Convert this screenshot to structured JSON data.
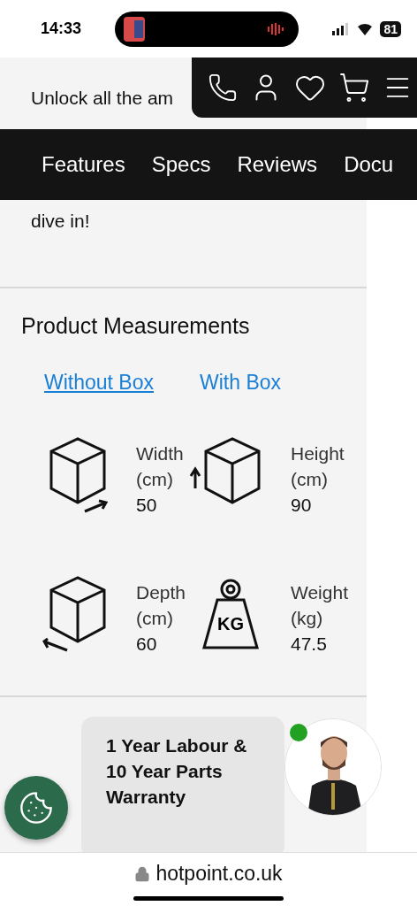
{
  "status_bar": {
    "time": "14:33",
    "battery": "81"
  },
  "intro": {
    "first_line": "Unlock all the am",
    "last_line": "dive in!"
  },
  "section_tabs": [
    {
      "label": "Features"
    },
    {
      "label": "Specs"
    },
    {
      "label": "Reviews"
    },
    {
      "label": "Docu"
    }
  ],
  "measurements": {
    "title": "Product Measurements",
    "box_tabs": [
      {
        "label": "Without Box",
        "selected": true
      },
      {
        "label": "With Box",
        "selected": false
      }
    ],
    "items": [
      {
        "kind": "width",
        "label": "Width",
        "unit": "(cm)",
        "value": "50"
      },
      {
        "kind": "height",
        "label": "Height",
        "unit": "(cm)",
        "value": "90"
      },
      {
        "kind": "depth",
        "label": "Depth",
        "unit": "(cm)",
        "value": "60"
      },
      {
        "kind": "weight",
        "label": "Weight",
        "unit": "(kg)",
        "value": "47.5",
        "icon_text": "KG"
      }
    ]
  },
  "warranty": {
    "lines": [
      "1 Year Labour &",
      "10 Year Parts",
      "Warranty"
    ]
  },
  "chat": {
    "online": true
  },
  "url_bar": {
    "domain": "hotpoint.co.uk"
  }
}
